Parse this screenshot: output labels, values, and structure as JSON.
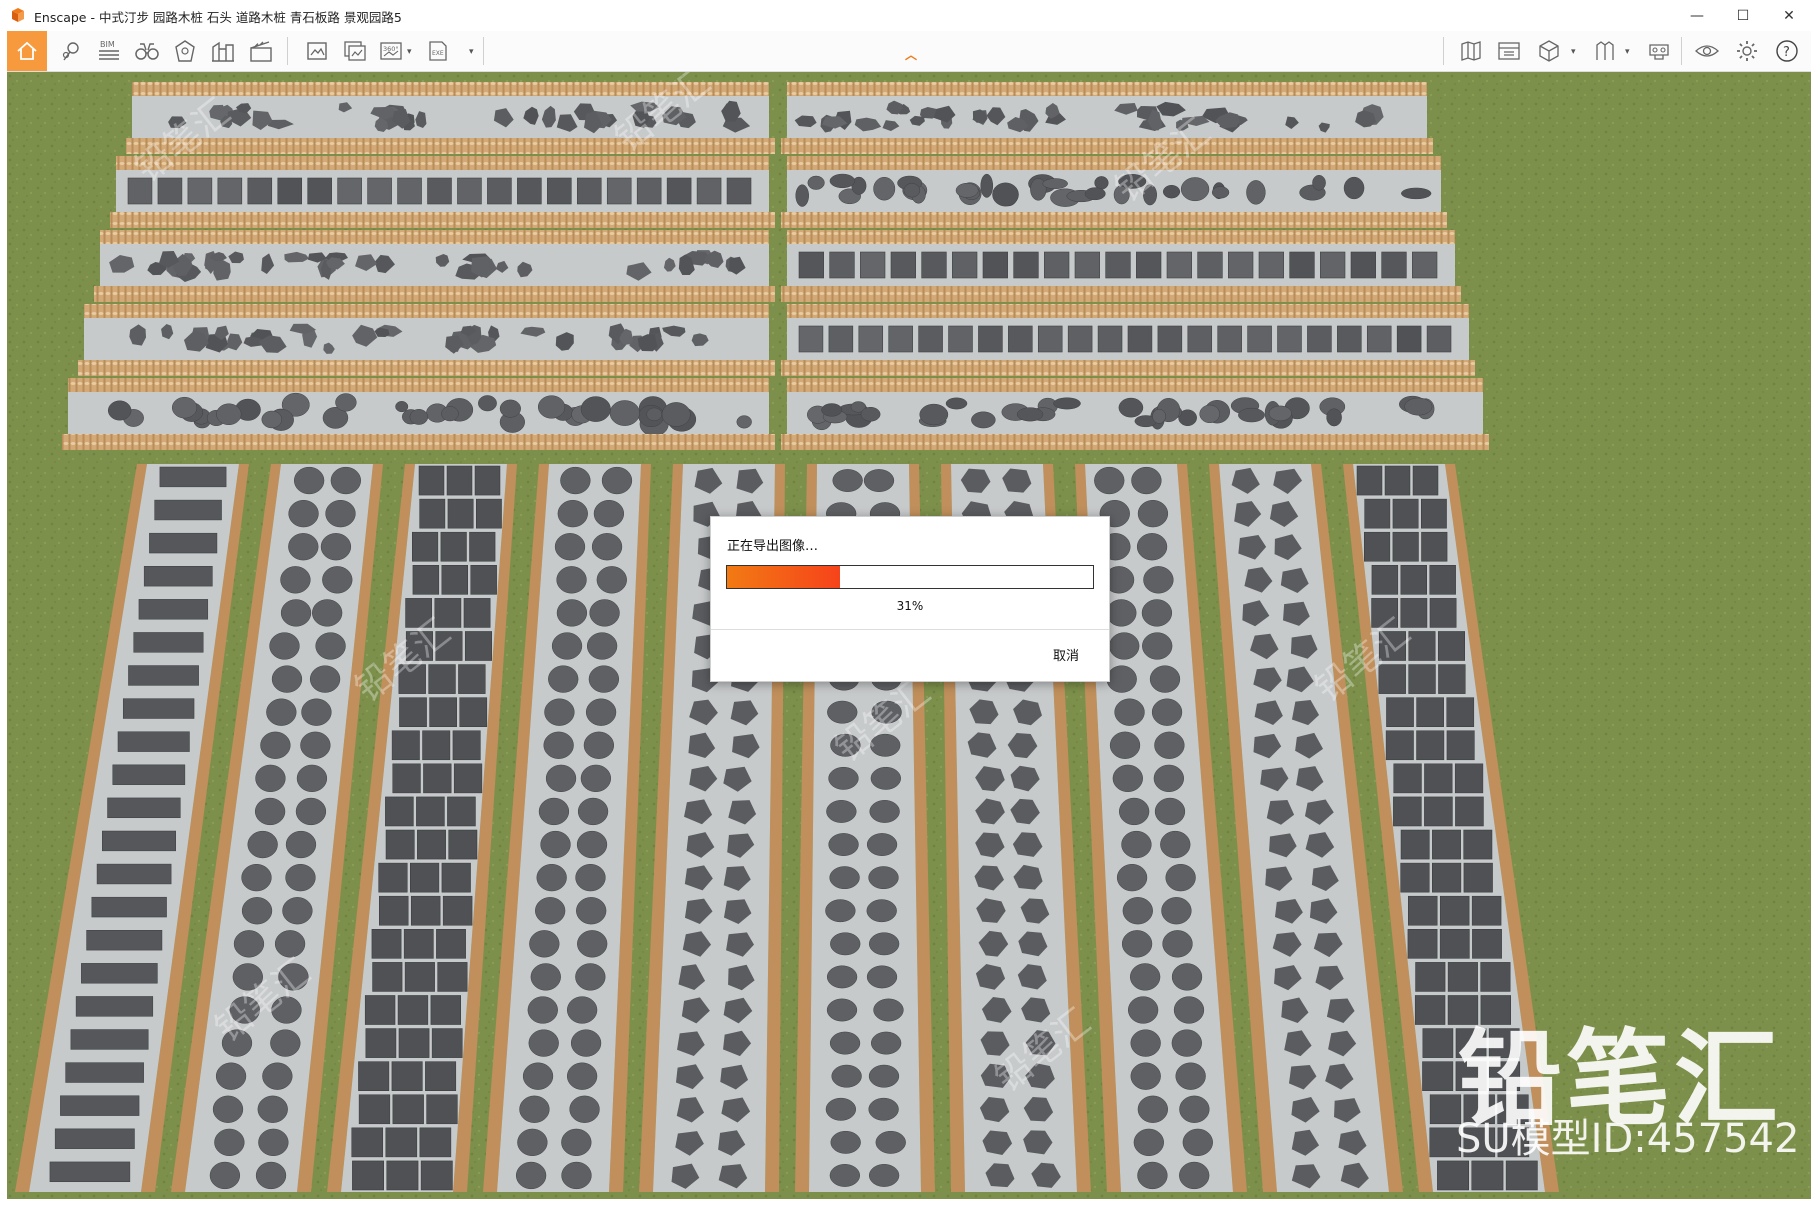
{
  "window": {
    "title": "Enscape - 中式汀步 园路木桩 石头 道路木桩 青石板路 景观园路5",
    "minimize_glyph": "—",
    "maximize_glyph": "☐",
    "close_glyph": "✕"
  },
  "toolbar": {
    "left_icons": [
      "home-icon",
      "location-pin-icon",
      "bim-icon",
      "binoculars-icon",
      "scene-icon",
      "buildings-icon",
      "clapperboard-icon",
      "screenshot-icon",
      "batch-render-icon",
      "panorama-360-icon",
      "video-export-icon",
      "exe-export-icon"
    ],
    "bim_label": "BIM",
    "pano_label": "360°",
    "exe_label": "EXE",
    "right_icons": [
      "map-icon",
      "asset-library-icon",
      "cube-icon",
      "materials-icon",
      "vr-headset-icon",
      "visual-settings-icon",
      "settings-gear-icon",
      "help-icon"
    ],
    "help_label": "?"
  },
  "dialog": {
    "title": "正在导出图像…",
    "progress_percent": 31,
    "progress_label": "31%",
    "cancel_label": "取消"
  },
  "watermark": {
    "main": "铅笔汇",
    "sub": "SU模型ID:457542"
  },
  "colors": {
    "accent": "#F79A3E",
    "progress": "#F25A17",
    "grass": "#7C8F4A",
    "path": "#C7CACB",
    "stone": "#5A5C5F",
    "post": "#C79A66"
  },
  "scene": {
    "top_paths": [
      {
        "pattern": "irregular-stones"
      },
      {
        "pattern": "rect-slabs-vertical"
      },
      {
        "pattern": "polygon-stones"
      },
      {
        "pattern": "large-flagstones"
      },
      {
        "pattern": "round-stones"
      },
      {
        "pattern": "crazy-paving"
      },
      {
        "pattern": "oval-stones"
      },
      {
        "pattern": "long-slabs"
      },
      {
        "pattern": "square-slabs"
      },
      {
        "pattern": "stepping-stones"
      }
    ],
    "bottom_paths": [
      {
        "pattern": "rect-slabs"
      },
      {
        "pattern": "round-stones"
      },
      {
        "pattern": "tile-grid"
      },
      {
        "pattern": "pebbles"
      },
      {
        "pattern": "polygon-stones"
      },
      {
        "pattern": "oval-stones"
      },
      {
        "pattern": "hexagon-stones"
      },
      {
        "pattern": "round-stones"
      },
      {
        "pattern": "irregular-stones"
      },
      {
        "pattern": "brick-paving"
      }
    ]
  }
}
